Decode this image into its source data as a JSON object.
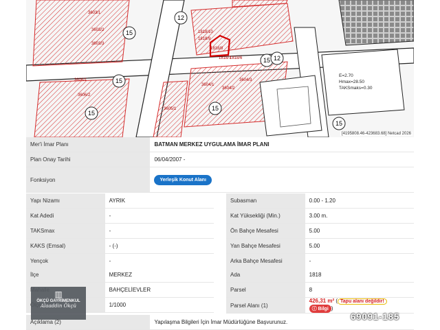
{
  "map": {
    "scale_labels": [
      "15",
      "15",
      "15",
      "15",
      "15",
      "12",
      "12",
      "15"
    ],
    "parcel_labels": [
      "1818/10",
      "1818/9",
      "1818/8",
      "1818/7",
      "1818/6",
      "3603/1",
      "3603/2",
      "3603/3",
      "3604/1",
      "3604/2",
      "3604/3",
      "3605/1",
      "3606/1",
      "3606/2"
    ],
    "density_note": [
      "E=2.70",
      "Hmax=28.50",
      "TAKSmaks=0.30"
    ],
    "coordinate_readout": "[4195808.46-423683.68] Netcad 2026",
    "hatch_colors": {
      "line": "#d42a2a",
      "road": "#ffffff",
      "block": "#555555"
    }
  },
  "plan": {
    "rows": [
      {
        "label": "Mer'i İmar Planı",
        "value": "BATMAN MERKEZ UYGULAMA İMAR PLANI"
      },
      {
        "label": "Plan Onay Tarihi",
        "value": "06/04/2007 -"
      },
      {
        "label": "Fonksiyon",
        "value": "Yerleşik Konut Alanı"
      }
    ]
  },
  "build_left": [
    {
      "label": "Yapı Nizamı",
      "value": "AYRIK"
    },
    {
      "label": "Kat Adedi",
      "value": "-"
    },
    {
      "label": "TAKSmax",
      "value": "-"
    },
    {
      "label": "KAKS (Emsal)",
      "value": "- (-)"
    },
    {
      "label": "Yençok",
      "value": "-"
    }
  ],
  "build_right": [
    {
      "label": "Subasman",
      "value": "0.00 - 1.20"
    },
    {
      "label": "Kat Yüksekliği (Min.)",
      "value": "3.00 m."
    },
    {
      "label": "Ön Bahçe Mesafesi",
      "value": "5.00"
    },
    {
      "label": "Yan Bahçe Mesafesi",
      "value": "5.00"
    },
    {
      "label": "Arka Bahçe Mesafesi",
      "value": "-"
    }
  ],
  "location_left": [
    {
      "label": "İlçe",
      "value": "MERKEZ"
    },
    {
      "label": "Mahalle",
      "value": "BAHÇELİEVLER"
    },
    {
      "label": "Ölçek",
      "value": "1/1000"
    }
  ],
  "location_right": [
    {
      "label": "Ada",
      "value": "1818"
    },
    {
      "label": "Parsel",
      "value": "8"
    },
    {
      "label": "Parsel Alanı (1)",
      "value": "426,31 m²",
      "warning": "Tapu alanı değildir!",
      "info": "Bilgi"
    }
  ],
  "footer": {
    "label": "Açıklama (2)",
    "value": "Yapılaşma Bilgileri İçin İmar Müdürlüğüne Başvurunuz."
  },
  "watermark": {
    "line1": "ÖKÇÜ GAYRİMENKUL",
    "line2": "Alaaddin Ökçü"
  },
  "listing_number": "69091-185",
  "colors": {
    "label_bg": "#e8e8e8",
    "button_blue": "#1a73c8",
    "area_red": "#d62020"
  }
}
